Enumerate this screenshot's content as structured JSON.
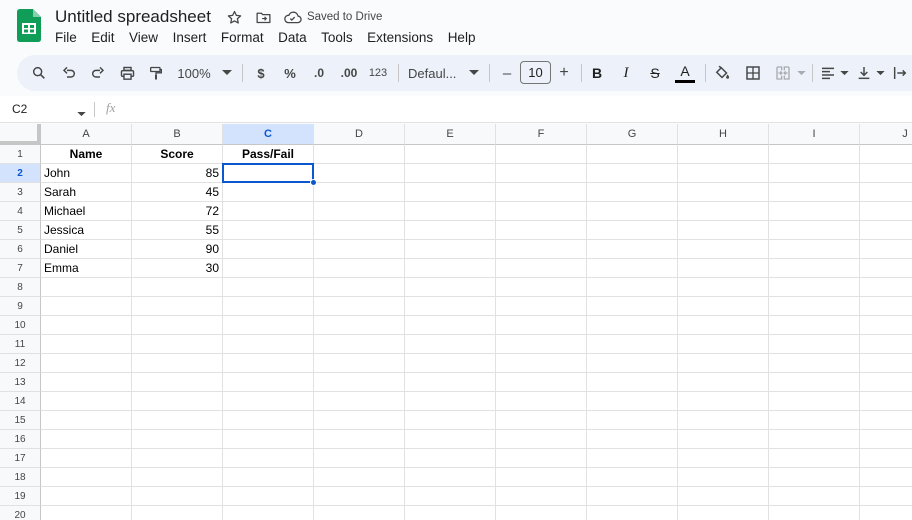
{
  "app": {
    "title": "Untitled spreadsheet",
    "save_status": "Saved to Drive",
    "accent_color": "#0b57d0",
    "logo_color": "#0f9d58"
  },
  "menu": [
    "File",
    "Edit",
    "View",
    "Insert",
    "Format",
    "Data",
    "Tools",
    "Extensions",
    "Help"
  ],
  "toolbar": {
    "zoom": "100%",
    "currency": "$",
    "percent": "%",
    "decrease_decimal": ".0",
    "increase_decimal": ".00",
    "more_formats": "123",
    "font": "Defaul...",
    "font_size": "10",
    "minus": "–",
    "plus": "+",
    "bold": "B",
    "italic": "I",
    "strikethrough": "S",
    "text_color": "A",
    "icons": [
      "search-icon",
      "undo-icon",
      "redo-icon",
      "print-icon",
      "paint-format-icon",
      "text-color-icon",
      "fill-color-icon",
      "borders-icon",
      "merge-cells-icon",
      "horizontal-align-icon",
      "vertical-align-icon",
      "text-wrap-icon"
    ]
  },
  "formula_bar": {
    "name_box": "C2",
    "fx_label": "fx",
    "formula": ""
  },
  "sheet": {
    "columns": [
      "A",
      "B",
      "C",
      "D",
      "E",
      "F",
      "G",
      "H",
      "I",
      "J"
    ],
    "rows": [
      "1",
      "2",
      "3",
      "4",
      "5",
      "6",
      "7",
      "8",
      "9",
      "10",
      "11",
      "12",
      "13",
      "14",
      "15",
      "16",
      "17",
      "18",
      "19",
      "20"
    ],
    "selected_cell": "C2",
    "headers": [
      "Name",
      "Score",
      "Pass/Fail"
    ],
    "data": [
      {
        "name": "John",
        "score": "85",
        "result": ""
      },
      {
        "name": "Sarah",
        "score": "45",
        "result": ""
      },
      {
        "name": "Michael",
        "score": "72",
        "result": ""
      },
      {
        "name": "Jessica",
        "score": "55",
        "result": ""
      },
      {
        "name": "Daniel",
        "score": "90",
        "result": ""
      },
      {
        "name": "Emma",
        "score": "30",
        "result": ""
      }
    ]
  }
}
